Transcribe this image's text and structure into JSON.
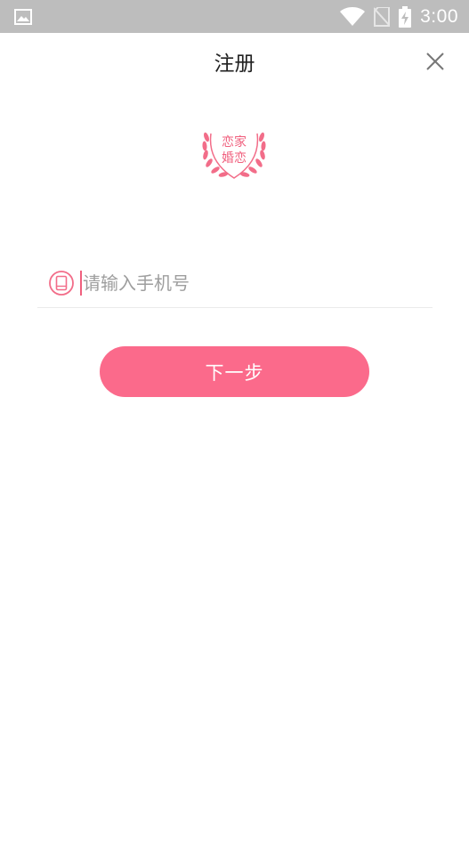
{
  "status_bar": {
    "time": "3:00",
    "icons": [
      "image-icon",
      "wifi-icon",
      "no-sim-icon",
      "battery-charging-icon"
    ]
  },
  "header": {
    "title": "注册",
    "close_icon": "close-icon"
  },
  "logo": {
    "text_line1": "恋家",
    "text_line2": "婚恋",
    "color": "#f0607e"
  },
  "form": {
    "phone_placeholder": "请输入手机号",
    "phone_value": "",
    "phone_icon": "phone-icon"
  },
  "actions": {
    "next_label": "下一步"
  },
  "colors": {
    "accent": "#fb6a8b",
    "status_bar": "#bdbdbd"
  }
}
